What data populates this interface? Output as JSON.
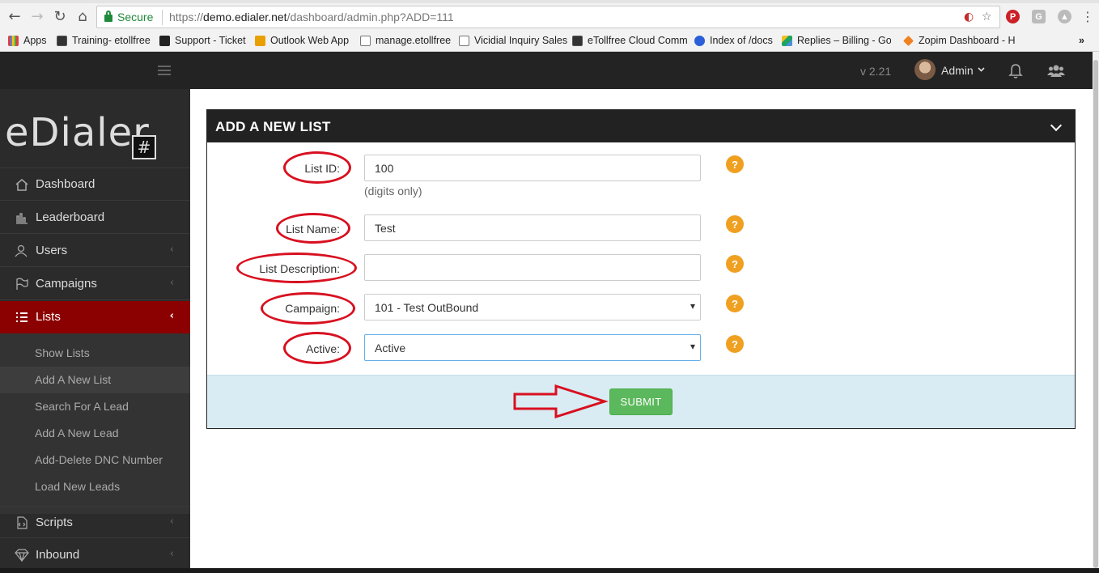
{
  "browser": {
    "secure_label": "Secure",
    "url_prefix": "https://",
    "url_host": "demo.edialer.net",
    "url_path": "/dashboard/admin.php?ADD=111",
    "bookmarks": [
      {
        "label": "Apps",
        "color": "#e04040"
      },
      {
        "label": "Training- etollfree",
        "color": "#333"
      },
      {
        "label": "Support - Ticket",
        "color": "#222"
      },
      {
        "label": "Outlook Web App",
        "color": "#e8a000"
      },
      {
        "label": "manage.etollfree",
        "color": "#fff"
      },
      {
        "label": "Vicidial Inquiry Sales",
        "color": "#fff"
      },
      {
        "label": "eTollfree Cloud Comm",
        "color": "#333"
      },
      {
        "label": "Index of /docs",
        "color": "#2b5fd9"
      },
      {
        "label": "Replies – Billing - Goo",
        "color": "#1da462"
      },
      {
        "label": "Zopim Dashboard - H",
        "color": "#f08020"
      }
    ],
    "more_label": "»"
  },
  "header": {
    "version": "v 2.21",
    "user_name": "Admin"
  },
  "sidebar": {
    "logo_text": "eDialer",
    "logo_mark": "#",
    "items": [
      {
        "label": "Dashboard",
        "arrow": ""
      },
      {
        "label": "Leaderboard",
        "arrow": ""
      },
      {
        "label": "Users",
        "arrow": "‹"
      },
      {
        "label": "Campaigns",
        "arrow": "‹"
      },
      {
        "label": "Lists",
        "arrow": "‹"
      },
      {
        "label": "Scripts",
        "arrow": "‹"
      },
      {
        "label": "Inbound",
        "arrow": "‹"
      }
    ],
    "sub_items": [
      "Show Lists",
      "Add A New List",
      "Search For A Lead",
      "Add A New Lead",
      "Add-Delete DNC Number",
      "Load New Leads"
    ]
  },
  "panel": {
    "title": "ADD A NEW LIST",
    "fields": {
      "list_id": {
        "label": "List ID:",
        "value": "100",
        "hint": "(digits only)"
      },
      "list_name": {
        "label": "List Name:",
        "value": "Test"
      },
      "list_description": {
        "label": "List Description:",
        "value": ""
      },
      "campaign": {
        "label": "Campaign:",
        "value": "101 - Test OutBound"
      },
      "active": {
        "label": "Active:",
        "value": "Active"
      }
    },
    "help_glyph": "?",
    "submit_label": "SUBMIT"
  },
  "colors": {
    "accent_red": "#8b0000",
    "annotation_red": "#d81020",
    "submit_green": "#5cb85c",
    "help_orange": "#f0a020"
  }
}
